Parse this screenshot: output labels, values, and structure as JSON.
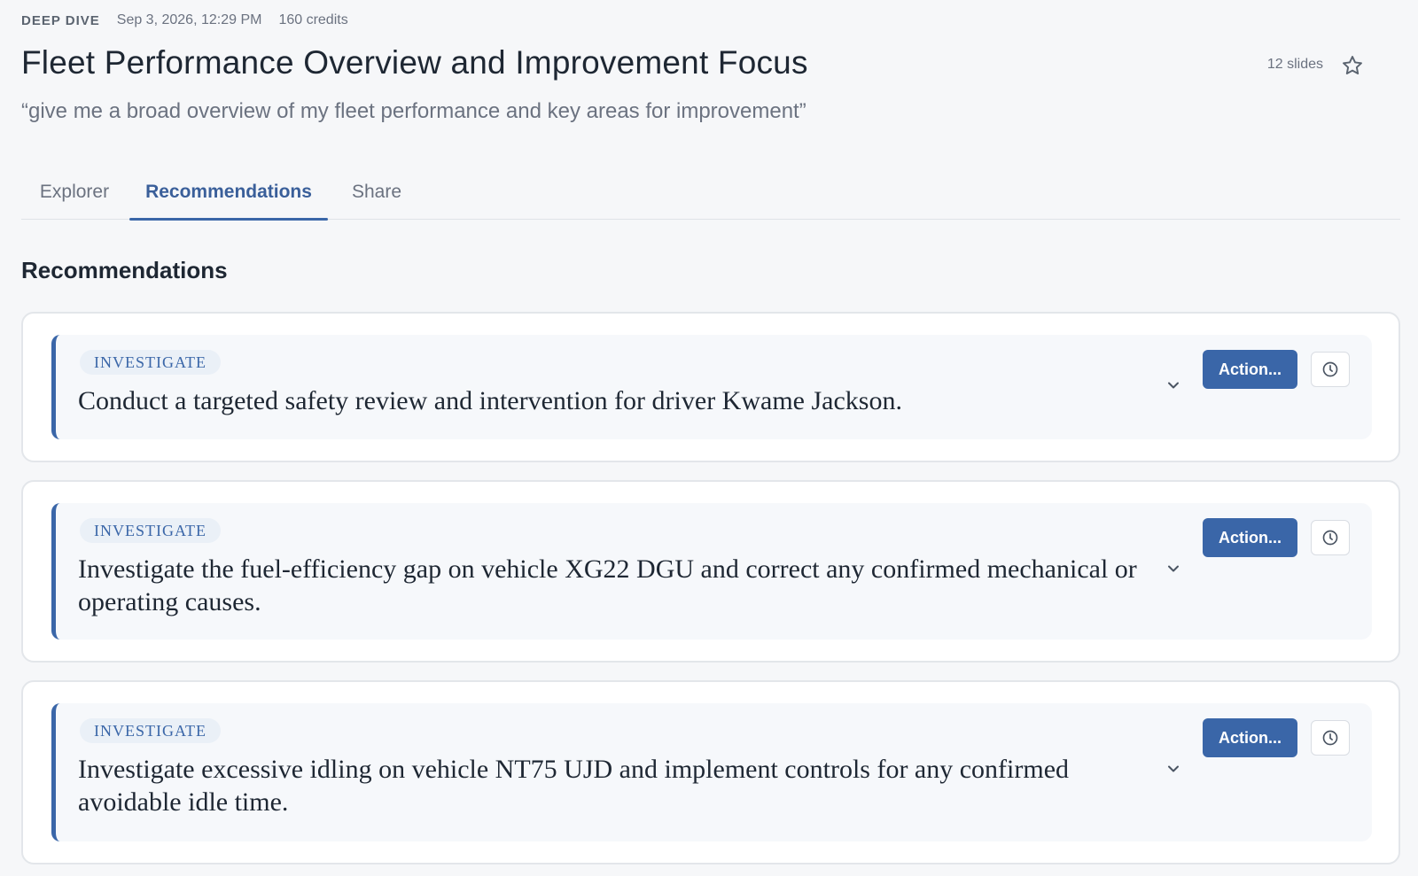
{
  "header": {
    "kind": "DEEP DIVE",
    "timestamp": "Sep 3, 2026, 12:29 PM",
    "credits": "160 credits",
    "title": "Fleet Performance Overview and Improvement Focus",
    "slides": "12 slides",
    "query": "“give me a broad overview of my fleet performance and key areas for improvement”"
  },
  "tabs": [
    {
      "label": "Explorer",
      "active": false
    },
    {
      "label": "Recommendations",
      "active": true
    },
    {
      "label": "Share",
      "active": false
    }
  ],
  "section_title": "Recommendations",
  "recommendations": [
    {
      "tag": "INVESTIGATE",
      "text": "Conduct a targeted safety review and intervention for driver Kwame Jackson.",
      "action_label": "Action..."
    },
    {
      "tag": "INVESTIGATE",
      "text": "Investigate the fuel-efficiency gap on vehicle XG22 DGU and correct any confirmed mechanical or operating causes.",
      "action_label": "Action..."
    },
    {
      "tag": "INVESTIGATE",
      "text": "Investigate excessive idling on vehicle NT75 UJD and implement controls for any confirmed avoidable idle time.",
      "action_label": "Action..."
    }
  ],
  "icons": {
    "favorite": "star-icon",
    "expand": "chevron-down-icon",
    "history": "clock-icon"
  },
  "colors": {
    "accent": "#3a66a8",
    "background": "#f6f7f9",
    "card": "#ffffff"
  }
}
